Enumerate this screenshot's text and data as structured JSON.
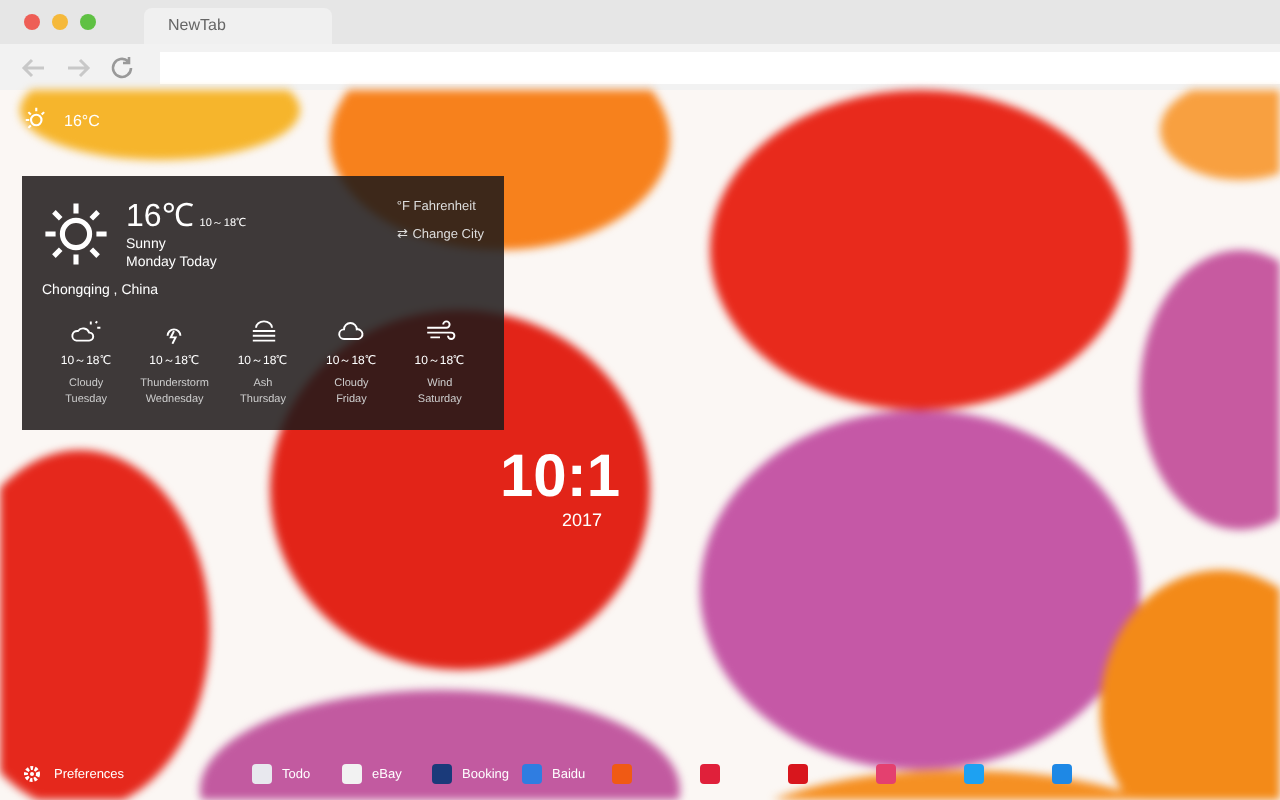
{
  "browser": {
    "tab_title": "NewTab"
  },
  "weather_mini": {
    "temperature": "16°C"
  },
  "weather_panel": {
    "temperature": "16℃",
    "range": "10～18℃",
    "condition": "Sunny",
    "day": "Monday Today",
    "location": "Chongqing , China",
    "unit_toggle": "°F  Fahrenheit",
    "change_city": "⇄  Change City",
    "forecast": [
      {
        "kind": "cloudy-sun",
        "range": "10～18℃",
        "condition": "Cloudy",
        "day": "Tuesday"
      },
      {
        "kind": "thunder",
        "range": "10～18℃",
        "condition": "Thunderstorm",
        "day": "Wednesday"
      },
      {
        "kind": "haze",
        "range": "10～18℃",
        "condition": "Ash",
        "day": "Thursday"
      },
      {
        "kind": "cloud",
        "range": "10～18℃",
        "condition": "Cloudy",
        "day": "Friday"
      },
      {
        "kind": "wind",
        "range": "10～18℃",
        "condition": "Wind",
        "day": "Saturday"
      }
    ]
  },
  "clock": {
    "time": "10:1",
    "date": "2017"
  },
  "bottom_bar": {
    "preferences": "Preferences",
    "shortcuts": [
      {
        "label": "Todo",
        "color": "#e8e8ee"
      },
      {
        "label": "eBay",
        "color": "#f2f2f2"
      },
      {
        "label": "Booking",
        "color": "#1a3a7a"
      },
      {
        "label": "Baidu",
        "color": "#2f7de1"
      },
      {
        "color": "#f05a14"
      },
      {
        "color": "#e0203a"
      },
      {
        "color": "#d8161d"
      },
      {
        "color": "#e4406f"
      },
      {
        "color": "#1da1f2"
      },
      {
        "color": "#1e88e5"
      }
    ]
  }
}
